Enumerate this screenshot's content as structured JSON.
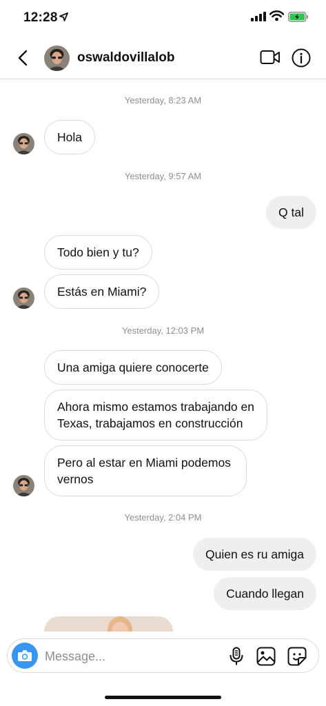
{
  "status_bar": {
    "time": "12:28"
  },
  "header": {
    "username": "oswaldovillalob"
  },
  "messages": {
    "ts1": "Yesterday, 8:23 AM",
    "m1": "Hola",
    "ts2": "Yesterday, 9:57 AM",
    "m2": "Q tal",
    "m3": "Todo bien y tu?",
    "m4": "Estás en Miami?",
    "ts3": "Yesterday, 12:03 PM",
    "m5": "Una amiga quiere conocerte",
    "m6_line1": "Ahora mismo estamos trabajando en",
    "m6_line2": "Texas, trabajamos en construcción",
    "m7_line1": "Pero al estar en Miami podemos",
    "m7_line2": "vernos",
    "ts4": "Yesterday, 2:04 PM",
    "m8": "Quien es ru amiga",
    "m9": "Cuando llegan"
  },
  "composer": {
    "placeholder": "Message..."
  },
  "icons": {
    "back": "chevron-left-icon",
    "video": "video-camera-icon",
    "info": "info-icon",
    "camera": "camera-icon",
    "mic": "microphone-icon",
    "gallery": "image-icon",
    "sticker": "sticker-icon"
  },
  "colors": {
    "accent": "#3797f0",
    "outgoing_bubble": "#efefef",
    "timestamp": "#8e8e8e",
    "border": "#dbdbdb"
  }
}
